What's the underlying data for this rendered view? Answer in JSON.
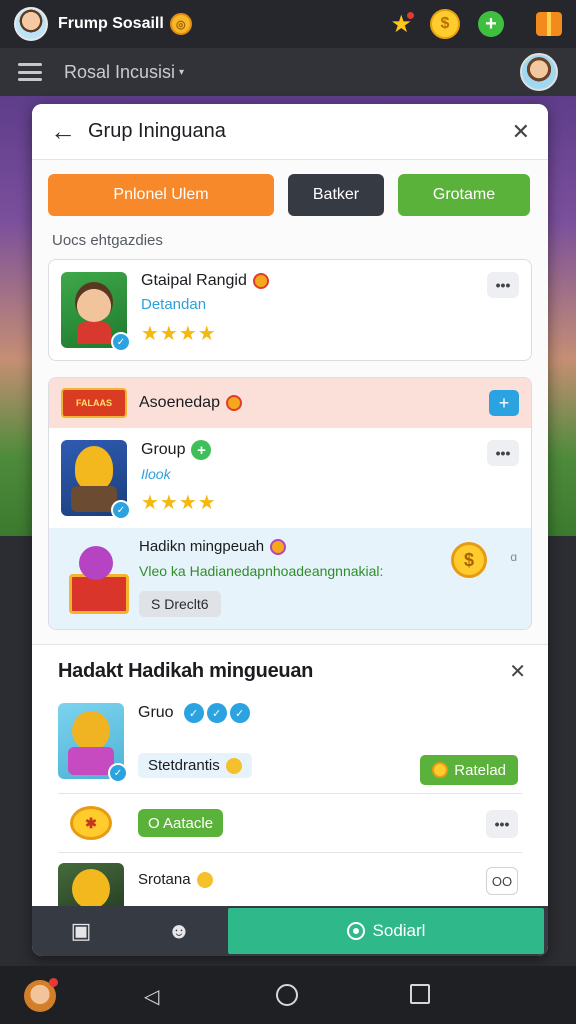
{
  "topbar": {
    "app_title": "Frump Sosaill",
    "icons": [
      "avatar",
      "coin-icon",
      "star-icon",
      "gold-coin-icon",
      "add-icon",
      "gift-icon"
    ]
  },
  "header": {
    "title": "Rosal Incusisi",
    "caret": "▾"
  },
  "dialog": {
    "title": "Grup Ininguаna",
    "back_icon": "arrow-left-icon",
    "close_icon": "close-icon",
    "buttons": {
      "orange": "Pnlonel Ulem",
      "dark": "Batker",
      "green": "Grotame"
    },
    "section_label": "Uocs ehtgazdies",
    "member1": {
      "name": "Gtaipal Rangid",
      "subtitle": "Detandan",
      "rating": "★★★★"
    },
    "highlight": {
      "title": "Asoenedap",
      "banner_text": "FALAAS"
    },
    "member2": {
      "name": "Group",
      "subtitle": "Ilook",
      "rating": "★★★★"
    },
    "gift": {
      "title": "Hadikn mingpeuah",
      "description": "Vleo ka Hadianedapnhoadeangnnakial:",
      "pill": "S Dreclt6",
      "dots": "ɑ"
    },
    "panel2": {
      "title": "Hadakt Hadikah mingueuan",
      "row1": {
        "name": "Gruo",
        "badges": [
          "✓",
          "✓",
          "✓"
        ],
        "status": "Stetdrantis",
        "reload": "Ratelad"
      },
      "row2": {
        "coin_text": "✱",
        "pill": "O Aatacle"
      },
      "row3": {
        "name": "Srotana",
        "badge": "OO"
      }
    },
    "footer": {
      "social_label": "Sodiarl"
    }
  },
  "colors": {
    "accent_orange": "#f7892a",
    "accent_green": "#5bb23a",
    "accent_blue": "#2ba3e0",
    "social_teal": "#2fb889",
    "dark_button": "#363a42"
  }
}
